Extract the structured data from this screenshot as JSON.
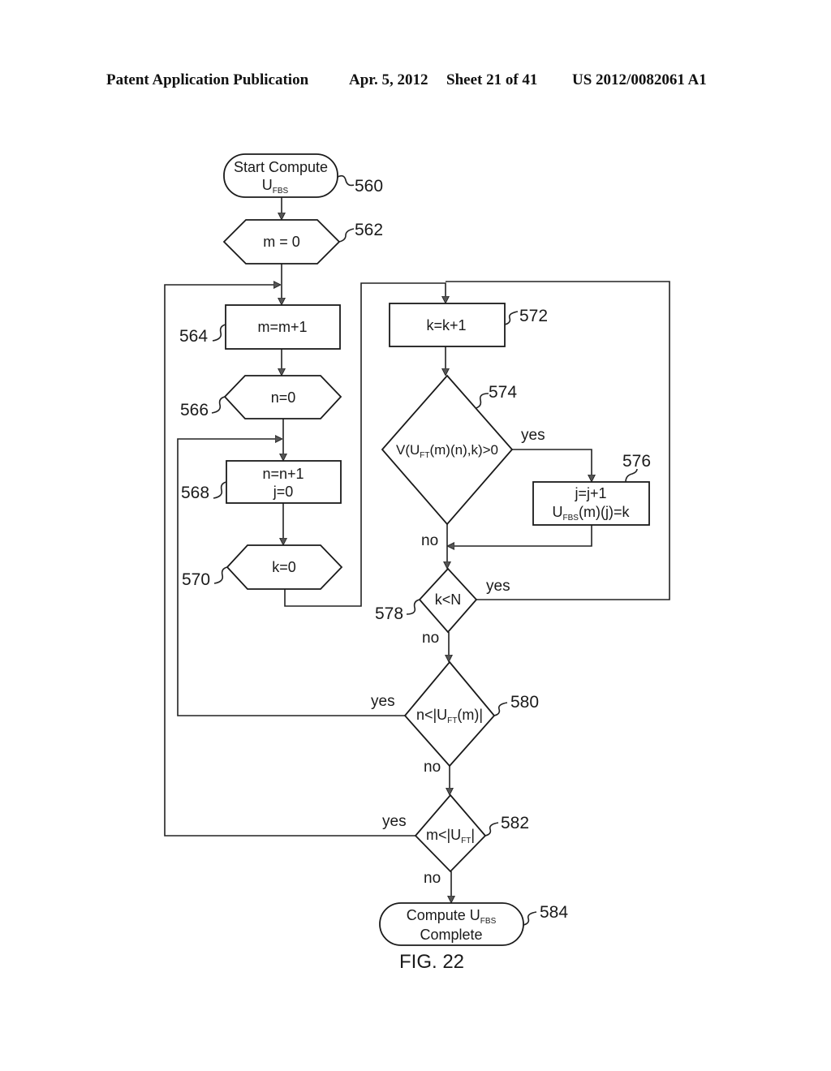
{
  "header": {
    "publication_type": "Patent Application Publication",
    "date": "Apr. 5, 2012",
    "sheet": "Sheet 21 of 41",
    "publication_number": "US 2012/0082061 A1"
  },
  "figure_label": "FIG. 22",
  "nodes": {
    "n560": {
      "ref": "560",
      "line1": "Start Compute",
      "line2_main": "U",
      "line2_sub": "FBS"
    },
    "n562": {
      "ref": "562",
      "text": "m = 0"
    },
    "n564": {
      "ref": "564",
      "text": "m=m+1"
    },
    "n566": {
      "ref": "566",
      "text": "n=0"
    },
    "n568": {
      "ref": "568",
      "line1": "n=n+1",
      "line2": "j=0"
    },
    "n570": {
      "ref": "570",
      "text": "k=0"
    },
    "n572": {
      "ref": "572",
      "text": "k=k+1"
    },
    "n574": {
      "ref": "574",
      "pre": "V(U",
      "sub": "FT",
      "post": "(m)(n),k)>0"
    },
    "n576": {
      "ref": "576",
      "line1": "j=j+1",
      "line2_pre": "U",
      "line2_sub": "FBS",
      "line2_post": "(m)(j)=k"
    },
    "n578": {
      "ref": "578",
      "text": "k<N"
    },
    "n580": {
      "ref": "580",
      "pre": "n<|U",
      "sub": "FT",
      "post": "(m)|"
    },
    "n582": {
      "ref": "582",
      "pre": "m<|U",
      "sub": "FT",
      "post": "|"
    },
    "n584": {
      "ref": "584",
      "line1_pre": "Compute U",
      "line1_sub": "FBS",
      "line2": "Complete"
    }
  },
  "edge_labels": {
    "yes_574": "yes",
    "no_574": "no",
    "yes_578": "yes",
    "no_578": "no",
    "yes_580": "yes",
    "no_580": "no",
    "yes_582": "yes",
    "no_582": "no"
  }
}
